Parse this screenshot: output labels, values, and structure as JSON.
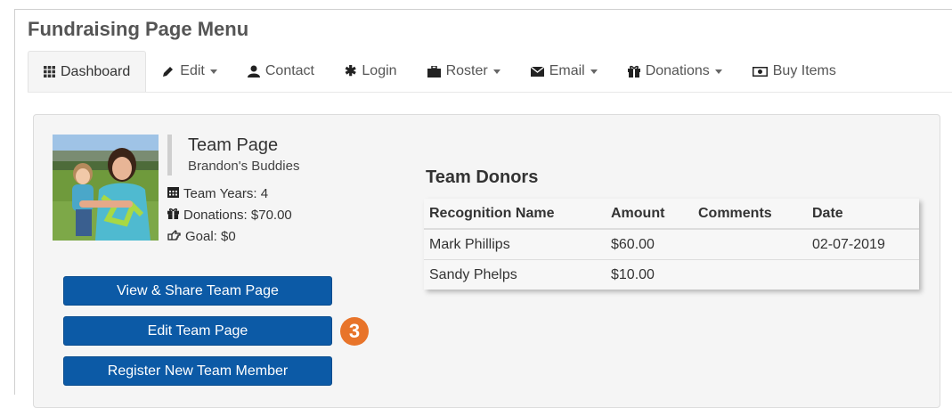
{
  "menu": {
    "title": "Fundraising Page Menu"
  },
  "nav": {
    "items": [
      {
        "label": "Dashboard",
        "icon": "grid-icon",
        "dropdown": false
      },
      {
        "label": "Edit",
        "icon": "pencil-icon",
        "dropdown": true
      },
      {
        "label": "Contact",
        "icon": "user-icon",
        "dropdown": false
      },
      {
        "label": "Login",
        "icon": "asterisk-icon",
        "dropdown": false
      },
      {
        "label": "Roster",
        "icon": "briefcase-icon",
        "dropdown": true
      },
      {
        "label": "Email",
        "icon": "envelope-icon",
        "dropdown": true
      },
      {
        "label": "Donations",
        "icon": "gift-icon",
        "dropdown": true
      },
      {
        "label": "Buy Items",
        "icon": "money-icon",
        "dropdown": false
      }
    ]
  },
  "team": {
    "title": "Team Page",
    "name": "Brandon's Buddies",
    "years": "Team Years: 4",
    "donations": "Donations: $70.00",
    "goal": "Goal: $0"
  },
  "buttons": {
    "view_share": "View & Share Team Page",
    "edit": "Edit Team Page",
    "register": "Register New Team Member"
  },
  "step_badge": "3",
  "donors": {
    "title": "Team Donors",
    "columns": [
      "Recognition Name",
      "Amount",
      "Comments",
      "Date"
    ],
    "rows": [
      [
        "Mark Phillips",
        "$60.00",
        "",
        "02-07-2019"
      ],
      [
        "Sandy Phelps",
        "$10.00",
        "",
        ""
      ]
    ]
  },
  "colors": {
    "button": "#0c5aa6",
    "badge": "#e8742a"
  }
}
